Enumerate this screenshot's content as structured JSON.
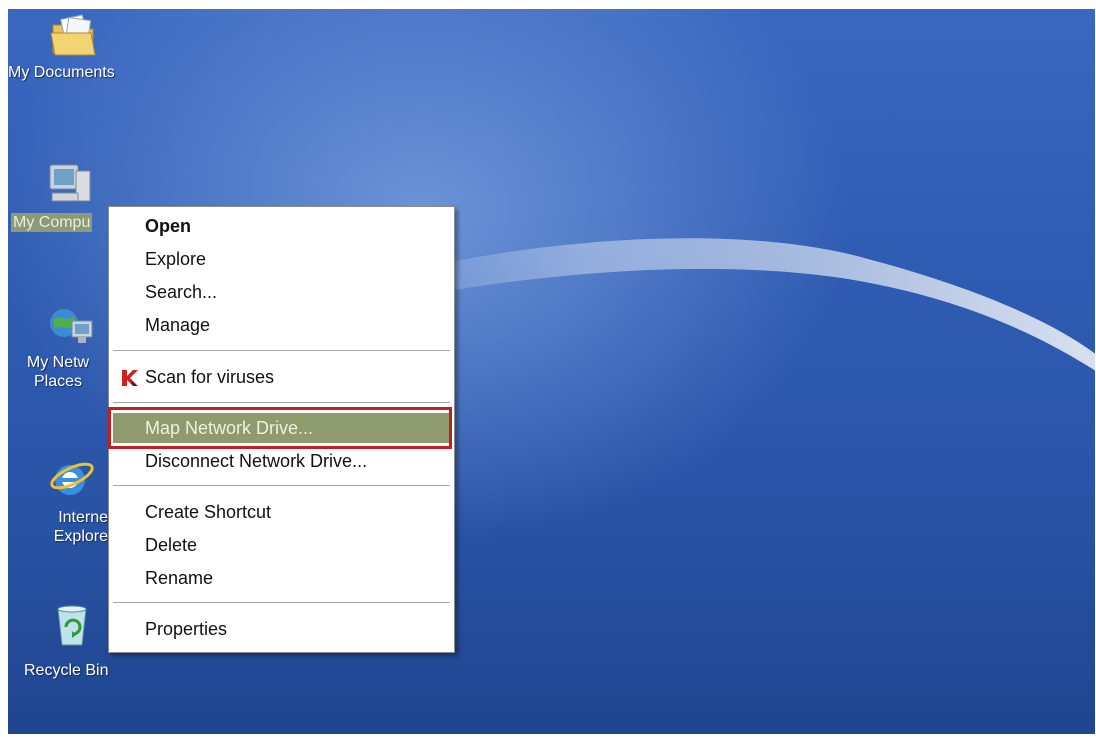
{
  "desktop": {
    "icons": [
      {
        "label": "My Documents",
        "icon": "my-documents-icon"
      },
      {
        "label": "My Compu",
        "icon": "my-computer-icon"
      },
      {
        "label": "My Netw\nPlaces",
        "icon": "my-network-places-icon"
      },
      {
        "label": "Interne\nExplore",
        "icon": "internet-explorer-icon"
      },
      {
        "label": "Recycle Bin",
        "icon": "recycle-bin-icon"
      }
    ]
  },
  "context_menu": {
    "open": "Open",
    "explore": "Explore",
    "search": "Search...",
    "manage": "Manage",
    "scan": "Scan for viruses",
    "map_drive": "Map Network Drive...",
    "disconnect_drive": "Disconnect Network Drive...",
    "create_shortcut": "Create Shortcut",
    "delete": "Delete",
    "rename": "Rename",
    "properties": "Properties"
  },
  "colors": {
    "hover_item": "#8e9b6c",
    "annotation_box": "#c41e1e"
  }
}
